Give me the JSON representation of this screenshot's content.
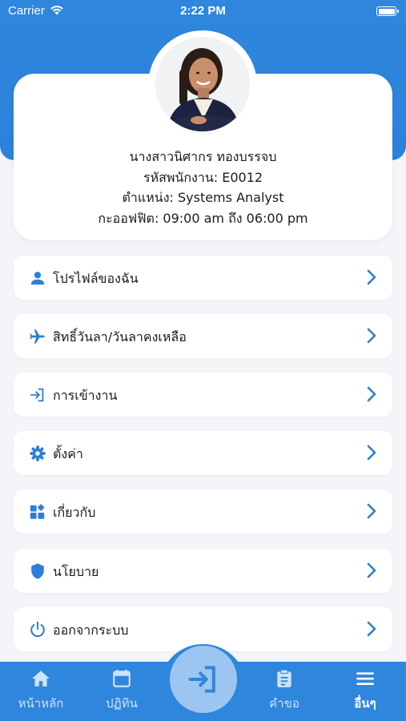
{
  "status_bar": {
    "carrier": "Carrier",
    "time": "2:22 PM"
  },
  "profile": {
    "name": "นางสาวนิศากร ทองบรรจบ",
    "employee_id": "รหัสพนักงาน: E0012",
    "position": "ตำแหน่ง: Systems Analyst",
    "office_hours": "กะออฟฟิต: 09:00 am ถึง 06:00 pm"
  },
  "menu": [
    {
      "label": "โปรไฟล์ของฉัน",
      "icon": "person-icon"
    },
    {
      "label": "สิทธิ์วันลา/วันลาคงเหลือ",
      "icon": "airplane-icon"
    },
    {
      "label": "การเข้างาน",
      "icon": "login-icon"
    },
    {
      "label": "ตั้งค่า",
      "icon": "gear-icon"
    },
    {
      "label": "เกี่ยวกับ",
      "icon": "widgets-icon"
    },
    {
      "label": "นโยบาย",
      "icon": "shield-icon"
    },
    {
      "label": "ออกจากระบบ",
      "icon": "power-icon"
    }
  ],
  "bottom_nav": {
    "home": "หน้าหลัก",
    "calendar": "ปฏิทิน",
    "requests": "คำขอ",
    "more": "อื่นๆ"
  },
  "colors": {
    "primary": "#2f86dd",
    "accent": "#2b7fd6",
    "center_button": "#9cc6f1",
    "background": "#f4f5f8"
  }
}
